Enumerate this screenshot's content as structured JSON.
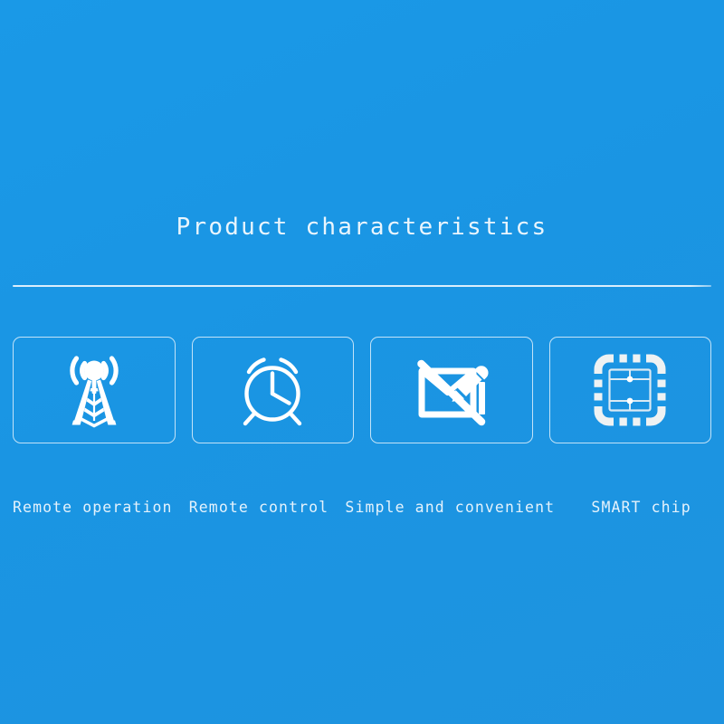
{
  "banner": {
    "background_color": "#1a97e5",
    "title": "Product characteristics",
    "text_color": "#e8f4fc",
    "divider_color": "#e4f3fd"
  },
  "features": [
    {
      "label": "Remote operation",
      "icon": "radio-tower-icon",
      "icon_color": "#ffffff"
    },
    {
      "label": "Remote control",
      "icon": "alarm-clock-icon",
      "icon_color": "#ffffff"
    },
    {
      "label": "Simple and convenient",
      "icon": "no-wiring-pencil-icon",
      "icon_color": "#ffffff"
    },
    {
      "label": "SMART chip",
      "icon": "smart-chip-icon",
      "icon_color": "#eef2f3"
    }
  ]
}
